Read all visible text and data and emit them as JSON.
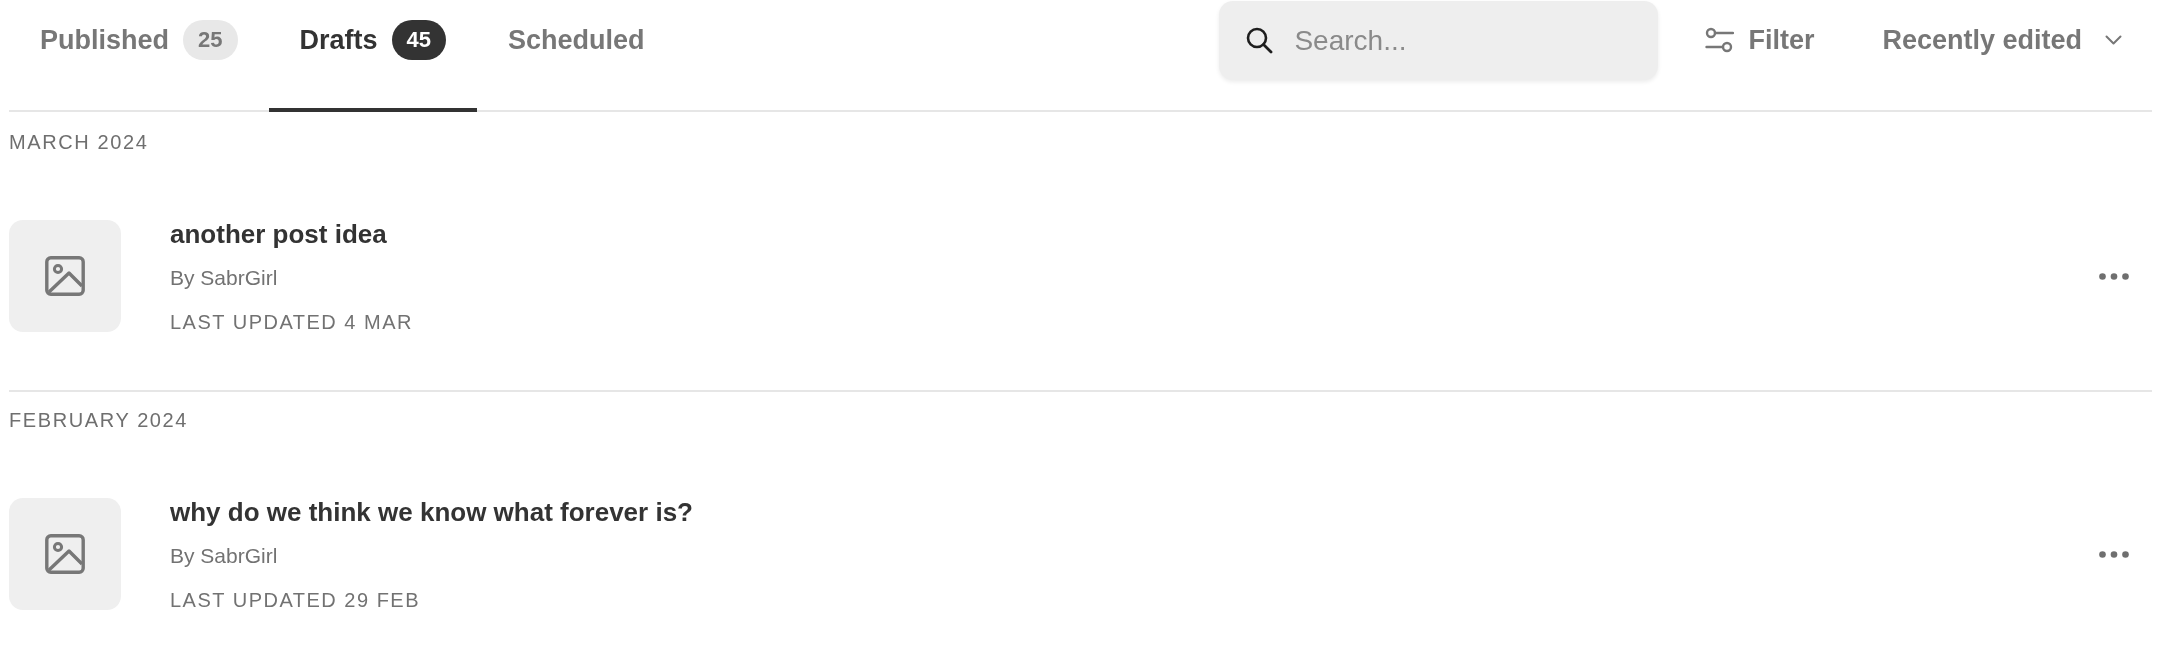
{
  "tabs": [
    {
      "label": "Published",
      "count": "25",
      "selected": false
    },
    {
      "label": "Drafts",
      "count": "45",
      "selected": true
    },
    {
      "label": "Scheduled",
      "selected": false
    }
  ],
  "search": {
    "placeholder": "Search..."
  },
  "filter_button": {
    "label": "Filter"
  },
  "sort_dropdown": {
    "label": "Recently edited"
  },
  "sections": [
    {
      "heading": "MARCH 2024",
      "posts": [
        {
          "title": "another post idea",
          "author": "By SabrGirl",
          "updated": "LAST UPDATED 4 MAR"
        }
      ]
    },
    {
      "heading": "FEBRUARY 2024",
      "posts": [
        {
          "title": "why do we think we know what forever is?",
          "author": "By SabrGirl",
          "updated": "LAST UPDATED 29 FEB"
        }
      ]
    }
  ]
}
